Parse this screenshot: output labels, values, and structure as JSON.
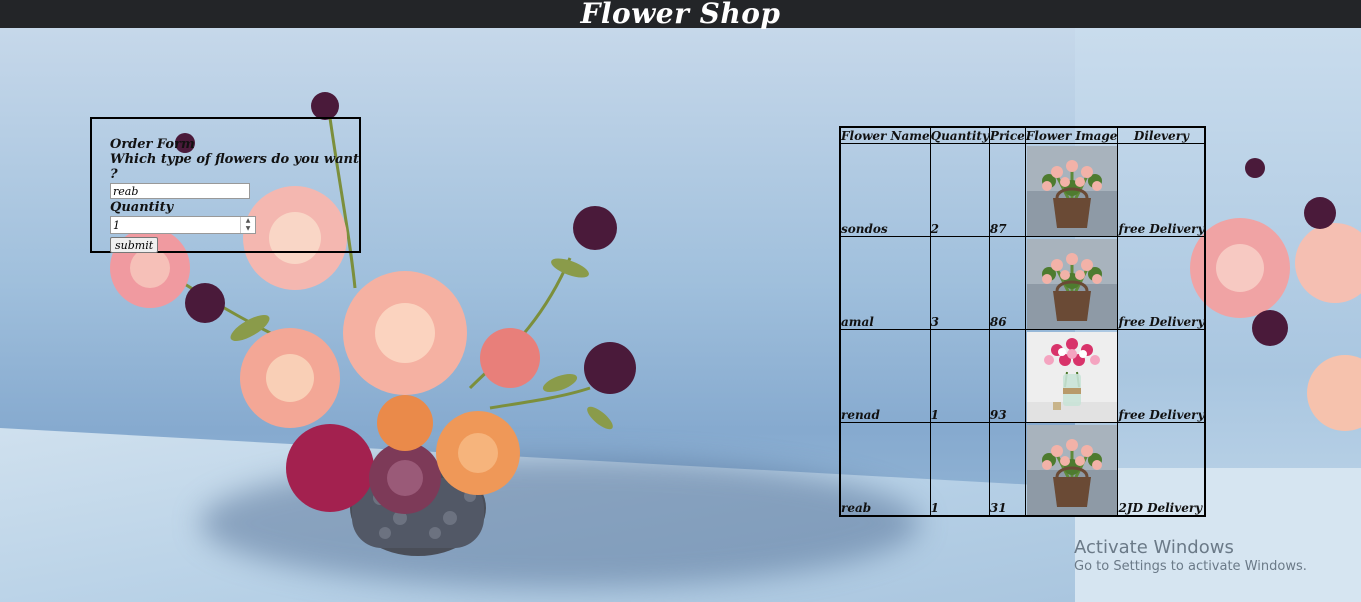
{
  "header": {
    "title": "Flower Shop"
  },
  "order_form": {
    "title": "Order Form",
    "question": "Which type of flowers do you want ?",
    "flower_value": "reab",
    "quantity_label": "Quantity",
    "quantity_value": "1",
    "submit_label": "submit"
  },
  "table": {
    "headers": [
      "Flower Name",
      "Quantity",
      "Price",
      "Flower Image",
      "Dilevery"
    ],
    "rows": [
      {
        "name": "sondos",
        "quantity": "2",
        "price": "87",
        "image": "basket-icon",
        "delivery": "free Delivery"
      },
      {
        "name": "amal",
        "quantity": "3",
        "price": "86",
        "image": "basket-icon",
        "delivery": "free Delivery"
      },
      {
        "name": "renad",
        "quantity": "1",
        "price": "93",
        "image": "vase-icon",
        "delivery": "free Delivery"
      },
      {
        "name": "reab",
        "quantity": "1",
        "price": "31",
        "image": "basket-icon",
        "delivery": "2JD Delivery"
      }
    ]
  },
  "watermark": {
    "title": "Activate Windows",
    "subtitle": "Go to Settings to activate Windows."
  },
  "colors": {
    "header_bg": "#232528",
    "wall": "#9fbfdc"
  }
}
